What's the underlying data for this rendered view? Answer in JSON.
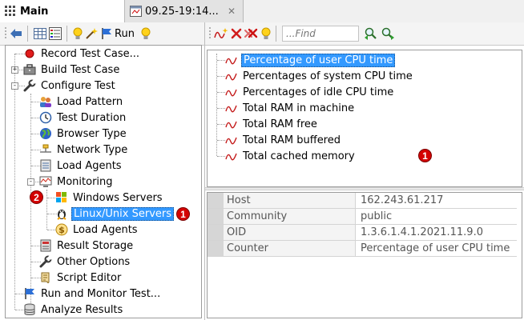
{
  "tabs": [
    {
      "label": "Main",
      "icon": "grid-icon"
    },
    {
      "label": "09.25-19:14...",
      "icon": "log-table-icon",
      "close_glyph": "✕"
    }
  ],
  "left_toolbar": {
    "run_label": "Run"
  },
  "right_toolbar": {
    "find_placeholder": "...Find"
  },
  "tree": [
    {
      "label": "Record Test Case...",
      "icon": "record-icon"
    },
    {
      "label": "Build Test Case",
      "icon": "briefcase-icon",
      "expander": "+"
    },
    {
      "label": "Configure Test",
      "icon": "wrench-icon",
      "expander": "-"
    },
    {
      "label": "Load Pattern",
      "icon": "users-icon"
    },
    {
      "label": "Test Duration",
      "icon": "clock-icon"
    },
    {
      "label": "Browser Type",
      "icon": "globe-icon"
    },
    {
      "label": "Network Type",
      "icon": "network-icon"
    },
    {
      "label": "Load Agents",
      "icon": "agents-icon"
    },
    {
      "label": "Monitoring",
      "icon": "monitoring-icon",
      "expander": "-"
    },
    {
      "label": "Windows Servers",
      "icon": "windows-icon"
    },
    {
      "label": "Linux/Unix Servers",
      "icon": "linux-icon",
      "selected": true
    },
    {
      "label": "Load Agents",
      "icon": "agent-dollar-icon"
    },
    {
      "label": "Result Storage",
      "icon": "storage-icon"
    },
    {
      "label": "Other Options",
      "icon": "wrench-icon"
    },
    {
      "label": "Script Editor",
      "icon": "scroll-icon"
    },
    {
      "label": "Run and Monitor Test...",
      "icon": "flag-icon"
    },
    {
      "label": "Analyze Results",
      "icon": "database-icon"
    }
  ],
  "counters": [
    {
      "label": "Percentage of user CPU time",
      "selected": true
    },
    {
      "label": "Percentages of system CPU time"
    },
    {
      "label": "Percentages of idle CPU time"
    },
    {
      "label": "Total RAM in machine"
    },
    {
      "label": "Total RAM free"
    },
    {
      "label": "Total RAM buffered"
    },
    {
      "label": "Total cached memory"
    }
  ],
  "properties": [
    {
      "name": "Host",
      "value": "162.243.61.217"
    },
    {
      "name": "Community",
      "value": "public"
    },
    {
      "name": "OID",
      "value": "1.3.6.1.4.1.2021.11.9.0"
    },
    {
      "name": "Counter",
      "value": "Percentage of user CPU time"
    }
  ],
  "callouts": {
    "tree_selected": "1",
    "tree_monitoring": "2",
    "counters": "1"
  },
  "colors": {
    "selection": "#3399ff",
    "callout": "#d40000"
  }
}
